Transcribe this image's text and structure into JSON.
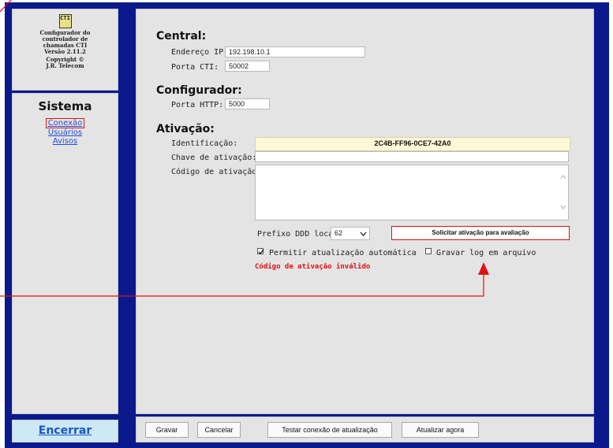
{
  "sidebar": {
    "logo_text": "CTI",
    "info_lines": [
      "Configurador do",
      "controlador de",
      "chamadas CTI",
      "Versão 2.11.2",
      "Copyright ©",
      "J.R. Telecom"
    ],
    "section_title": "Sistema",
    "nav": [
      "Conexão",
      "Usuários",
      "Avisos"
    ],
    "logout": "Encerrar"
  },
  "central": {
    "title": "Central:",
    "ip_label": "Endereço IP:",
    "ip_value": "192.198.10.1",
    "port_label": "Porta CTI:",
    "port_value": "50002"
  },
  "configurador": {
    "title": "Configurador:",
    "http_label": "Porta HTTP:",
    "http_value": "5000"
  },
  "ativacao": {
    "title": "Ativação:",
    "id_label": "Identificação:",
    "id_value": "2C4B-FF96-0CE7-42A0",
    "key_label": "Chave de ativação:",
    "code_label": "Código de ativação:",
    "ddd_label": "Prefixo DDD local:",
    "ddd_value": "62",
    "request_button": "Solicitar ativação para avaliação",
    "auto_update_label": "Permitir atualização automática",
    "auto_update_checked": true,
    "log_label": "Gravar log em arquivo",
    "log_checked": false,
    "error": "Código de ativação inválido"
  },
  "footer": {
    "save": "Gravar",
    "cancel": "Cancelar",
    "test": "Testar conexão de atualização",
    "update": "Atualizar agora"
  },
  "colors": {
    "frame": "#0a1a8c",
    "panel": "#e4e4e4",
    "link": "#1f4fd8",
    "highlight": "#e01010",
    "id_background": "#fff8d6"
  }
}
